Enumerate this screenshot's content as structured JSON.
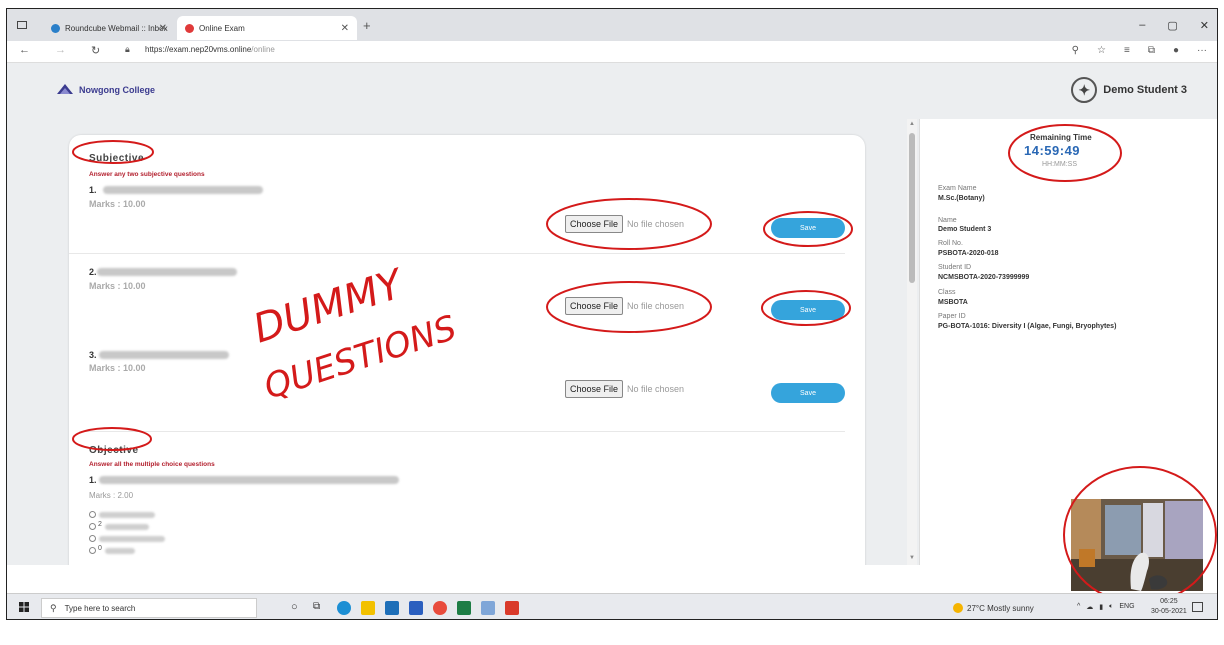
{
  "browser": {
    "tabs": [
      {
        "label": "Roundcube Webmail :: Inbox"
      },
      {
        "label": "Online Exam"
      }
    ],
    "url_host": "https://exam.nep20vms.online",
    "url_path": "/online",
    "window_controls": [
      "–",
      "▢",
      "✕"
    ]
  },
  "header": {
    "college": "Nowgong College",
    "user": "Demo Student 3"
  },
  "subjective": {
    "title": "Subjective",
    "instruction": "Answer any two subjective questions",
    "questions": [
      {
        "num": "1.",
        "marks": "Marks : 10.00"
      },
      {
        "num": "2.",
        "marks": "Marks : 10.00"
      },
      {
        "num": "3.",
        "marks": "Marks : 10.00"
      }
    ],
    "choose_label": "Choose File",
    "file_status": "No file chosen",
    "save_label": "Save"
  },
  "objective": {
    "title": "Objective",
    "instruction": "Answer all the multiple choice questions",
    "questions": [
      {
        "num": "1.",
        "marks": "Marks : 2.00",
        "options": [
          "",
          "2",
          "",
          "0"
        ]
      }
    ]
  },
  "panel": {
    "remaining_label": "Remaining Time",
    "remaining_value": "14:59:49",
    "remaining_format": "HH:MM:SS",
    "fields": [
      {
        "label": "Exam Name",
        "value": "M.Sc.(Botany)"
      },
      {
        "label": "Name",
        "value": "Demo Student 3"
      },
      {
        "label": "Roll No.",
        "value": "PSBOTA-2020-018"
      },
      {
        "label": "Student ID",
        "value": "NCMSBOTA-2020-73999999"
      },
      {
        "label": "Class",
        "value": "MSBOTA"
      },
      {
        "label": "Paper ID",
        "value": "PG-BOTA-1016: Diversity I (Algae, Fungi, Bryophytes)"
      }
    ]
  },
  "annotation": {
    "line1": "DUMMY",
    "line2": "QUESTIONS",
    "color": "#d41a1a"
  },
  "taskbar": {
    "search_placeholder": "Type here to search",
    "weather": "27°C  Mostly sunny",
    "lang": "ENG",
    "time": "06:25",
    "date": "30-05-2021"
  },
  "colors": {
    "accent": "#35a4dc",
    "timer": "#2a68b5",
    "instruction_red": "#b3202e"
  }
}
